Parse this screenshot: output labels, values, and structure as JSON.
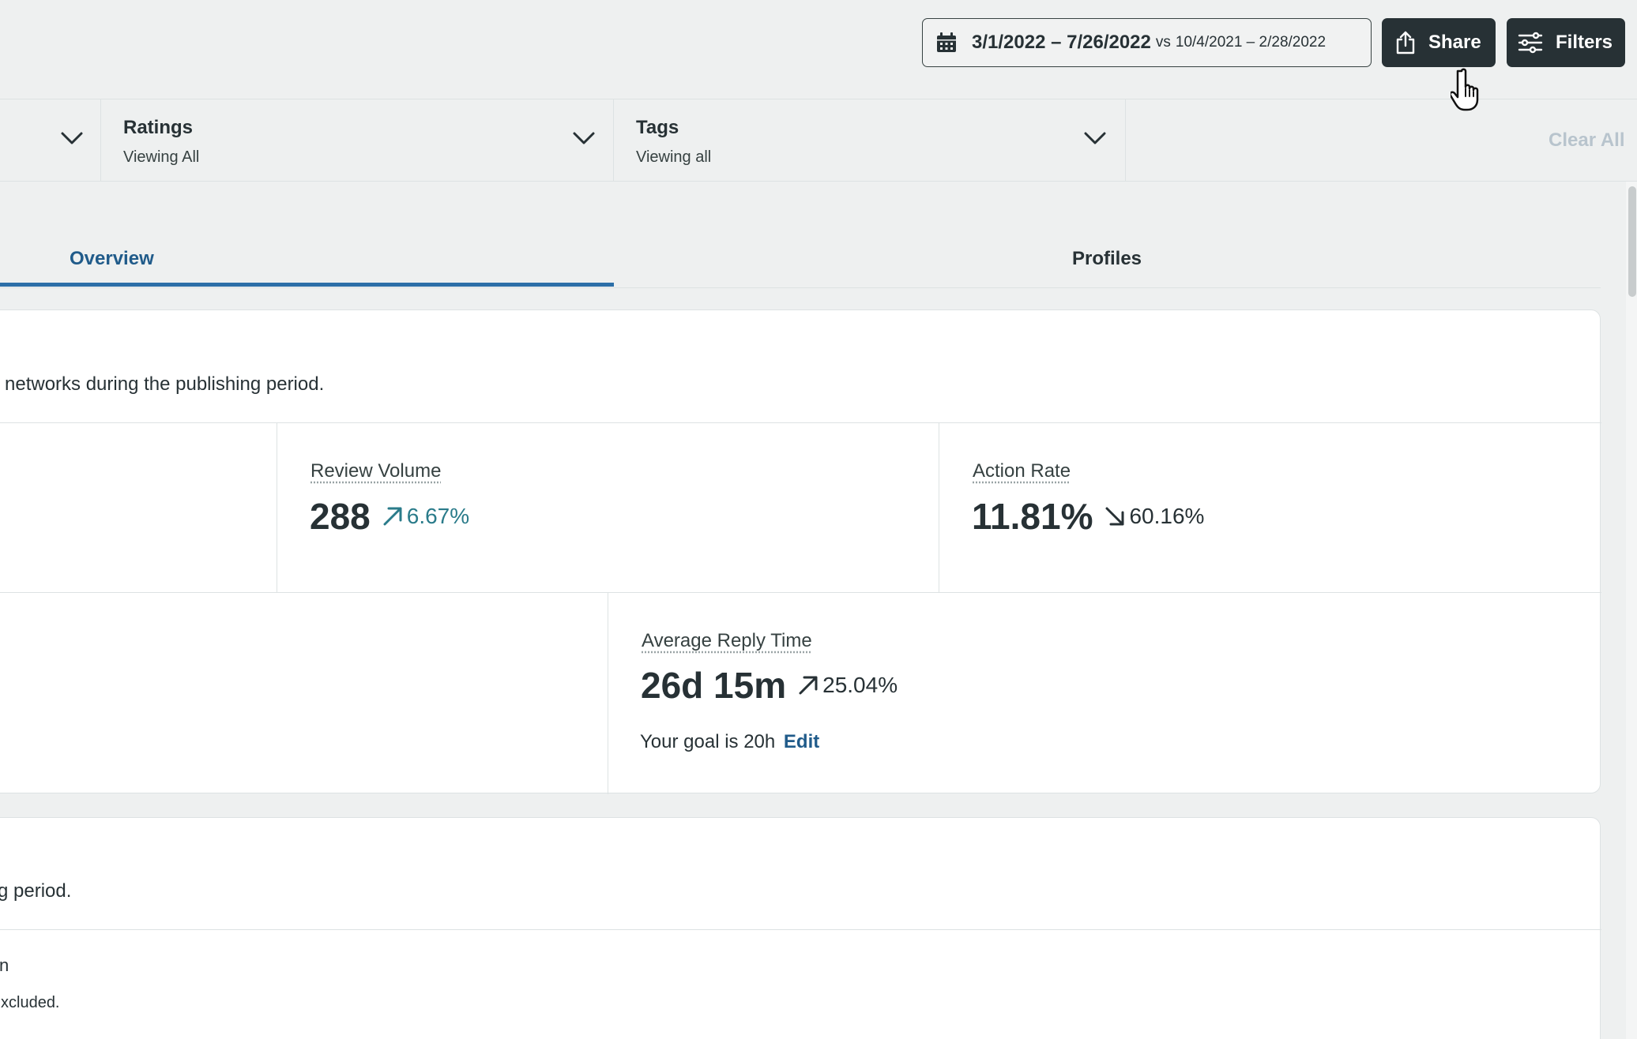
{
  "header": {
    "date_range": "3/1/2022 – 7/26/2022",
    "compare_prefix": "vs",
    "compare_range": "10/4/2021 – 2/28/2022",
    "share_label": "Share",
    "filters_label": "Filters"
  },
  "filters": {
    "ratings": {
      "title": "Ratings",
      "value": "Viewing All"
    },
    "tags": {
      "title": "Tags",
      "value": "Viewing all"
    },
    "clear_all": "Clear All"
  },
  "tabs": [
    {
      "label": "Overview",
      "active": true
    },
    {
      "label": "Profiles",
      "active": false
    }
  ],
  "summary_card": {
    "description": "networks during the publishing period.",
    "metrics": {
      "review_volume": {
        "label": "Review Volume",
        "value": "288",
        "change": "6.67%",
        "direction": "up"
      },
      "action_rate": {
        "label": "Action Rate",
        "value": "11.81%",
        "change": "60.16%",
        "direction": "down"
      },
      "avg_reply_time": {
        "label": "Average Reply Time",
        "value": "26d 15m",
        "change": "25.04%",
        "direction": "up"
      }
    },
    "goal_text": "Your goal is 20h",
    "goal_edit": "Edit"
  },
  "second_card": {
    "description": "g period.",
    "line1": "n",
    "line2": "xcluded."
  },
  "colors": {
    "accent": "#205b8a",
    "dark_button": "#273135",
    "positive": "#2a7b8a",
    "disabled_text": "#b8c4cd"
  }
}
